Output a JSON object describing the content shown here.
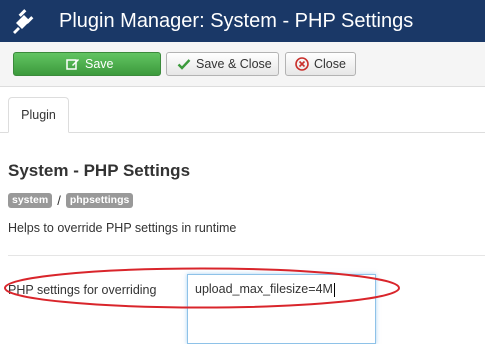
{
  "window": {
    "title": "Plugin Manager: System - PHP Settings",
    "icon": "plug-icon",
    "header_color": "#1a3867"
  },
  "toolbar": {
    "save_label": "Save",
    "save_icon": "edit-icon",
    "save_close_label": "Save & Close",
    "save_close_icon": "check-icon",
    "close_label": "Close",
    "close_icon": "close-circle-icon",
    "save_color": "#46a546"
  },
  "tabs": [
    {
      "label": "Plugin",
      "active": true
    }
  ],
  "plugin": {
    "heading": "System - PHP Settings",
    "labels": [
      "system",
      "phpsettings"
    ],
    "separator": "/",
    "description": "Helps to override PHP settings in runtime"
  },
  "form": {
    "field_label": "PHP settings for overriding",
    "field_value": "upload_max_filesize=4M",
    "highlight_color": "#d9252b"
  }
}
